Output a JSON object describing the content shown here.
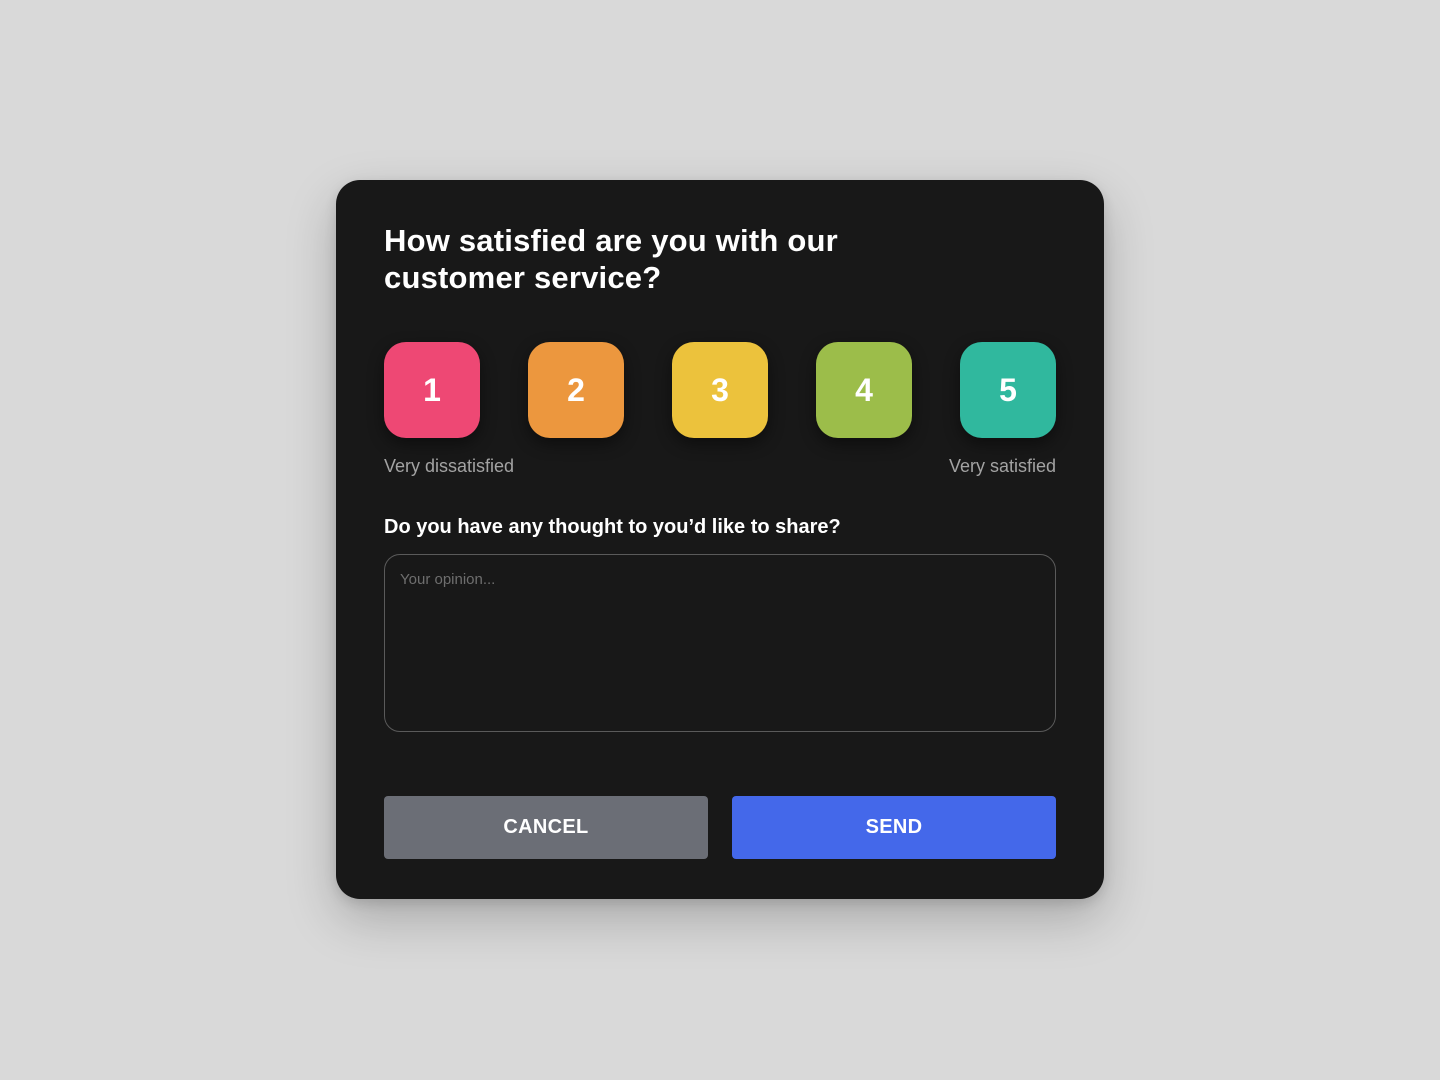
{
  "survey": {
    "title": "How satisfied are you with our customer service?",
    "ratings": [
      {
        "label": "1",
        "color": "#ee4874"
      },
      {
        "label": "2",
        "color": "#ec973e"
      },
      {
        "label": "3",
        "color": "#ecc23c"
      },
      {
        "label": "4",
        "color": "#9cbd4a"
      },
      {
        "label": "5",
        "color": "#30b89e"
      }
    ],
    "scale_low_label": "Very dissatisfied",
    "scale_high_label": "Very satisfied",
    "question": "Do you have any thought to you’d like to share?",
    "opinion": {
      "value": "",
      "placeholder": "Your opinion..."
    }
  },
  "actions": {
    "cancel_label": "CANCEL",
    "cancel_color": "#6b6e76",
    "send_label": "SEND",
    "send_color": "#4468ea"
  },
  "theme": {
    "page_background": "#d9d9d9",
    "card_background": "#181818"
  }
}
